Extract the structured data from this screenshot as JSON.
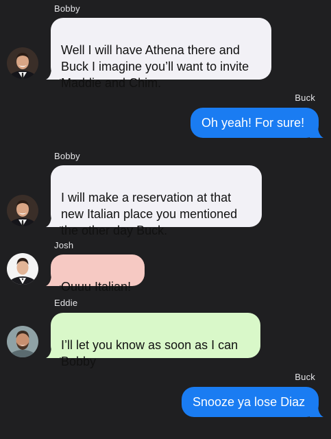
{
  "messages": [
    {
      "sender": "Bobby",
      "text": "Well I will have Athena there and\nBuck I imagine you’ll want to invite\nMaddie and Chim.",
      "direction": "incoming",
      "bubble_color": "#f2f1f6"
    },
    {
      "sender": "Buck",
      "text": "Oh yeah! For sure!",
      "direction": "outgoing",
      "bubble_color": "#1a7cf2"
    },
    {
      "sender": "Bobby",
      "text": "I will make a reservation at that\nnew Italian place you mentioned\nthe other day Buck.",
      "direction": "incoming",
      "bubble_color": "#f2f1f6"
    },
    {
      "sender": "Josh",
      "text": "Ouuu Italian!",
      "direction": "incoming",
      "bubble_color": "#f6c9c3"
    },
    {
      "sender": "Eddie",
      "text": "I’ll let you know as soon as I can\nBobby",
      "direction": "incoming",
      "bubble_color": "#d9f8c9"
    },
    {
      "sender": "Buck",
      "text": "Snooze ya lose Diaz",
      "direction": "outgoing",
      "bubble_color": "#1a7cf2"
    }
  ],
  "avatars": {
    "bobby": "avatar-bobby",
    "josh": "avatar-josh",
    "eddie": "avatar-eddie"
  },
  "colors": {
    "background": "#1f1f21",
    "sender_label": "#e6e6e9",
    "outgoing_bubble": "#1a7cf2",
    "bobby_bubble": "#f2f1f6",
    "josh_bubble": "#f6c9c3",
    "eddie_bubble": "#d9f8c9"
  }
}
